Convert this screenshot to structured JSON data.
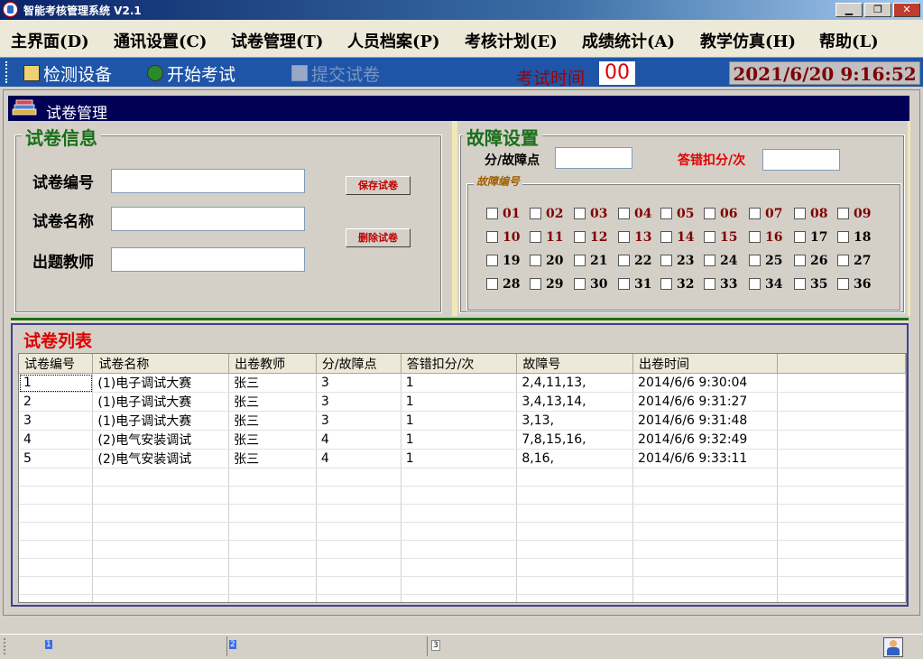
{
  "window": {
    "title": "智能考核管理系统 V2.1"
  },
  "menu": [
    "主界面(D)",
    "通讯设置(C)",
    "试卷管理(T)",
    "人员档案(P)",
    "考核计划(E)",
    "成绩统计(A)",
    "教学仿真(H)",
    "帮助(L)"
  ],
  "toolbar": {
    "detect": "检测设备",
    "start": "开始考试",
    "submit": "提交试卷",
    "exam_time_label": "考试时间",
    "exam_time_value": "00",
    "clock": "2021/6/20 9:16:52"
  },
  "subwindow": {
    "title": "试卷管理"
  },
  "paper_info": {
    "title": "试卷信息",
    "id_label": "试卷编号",
    "name_label": "试卷名称",
    "teacher_label": "出题教师",
    "save_label": "保存试卷",
    "delete_label": "删除试卷"
  },
  "fault_settings": {
    "title": "故障设置",
    "points_label": "分/故障点",
    "penalty_label": "答错扣分/次",
    "fault_no_title": "故障编号",
    "faults": [
      "01",
      "02",
      "03",
      "04",
      "05",
      "06",
      "07",
      "08",
      "09",
      "10",
      "11",
      "12",
      "13",
      "14",
      "15",
      "16",
      "17",
      "18",
      "19",
      "20",
      "21",
      "22",
      "23",
      "24",
      "25",
      "26",
      "27",
      "28",
      "29",
      "30",
      "31",
      "32",
      "33",
      "34",
      "35",
      "36"
    ]
  },
  "paper_list": {
    "title": "试卷列表",
    "columns": [
      "试卷编号",
      "试卷名称",
      "出卷教师",
      "分/故障点",
      "答错扣分/次",
      "故障号",
      "出卷时间"
    ],
    "rows": [
      [
        "1",
        "(1)电子调试大赛",
        "张三",
        "3",
        "1",
        "2,4,11,13,",
        "2014/6/6  9:30:04"
      ],
      [
        "2",
        "(1)电子调试大赛",
        "张三",
        "3",
        "1",
        "3,4,13,14,",
        "2014/6/6  9:31:27"
      ],
      [
        "3",
        "(1)电子调试大赛",
        "张三",
        "3",
        "1",
        "3,13,",
        "2014/6/6  9:31:48"
      ],
      [
        "4",
        "(2)电气安装调试",
        "张三",
        "4",
        "1",
        "7,8,15,16,",
        "2014/6/6  9:32:49"
      ],
      [
        "5",
        "(2)电气安装调试",
        "张三",
        "4",
        "1",
        "8,16,",
        "2014/6/6  9:33:11"
      ]
    ]
  },
  "statusbar": {
    "panels": [
      "1",
      "2",
      "3"
    ]
  }
}
